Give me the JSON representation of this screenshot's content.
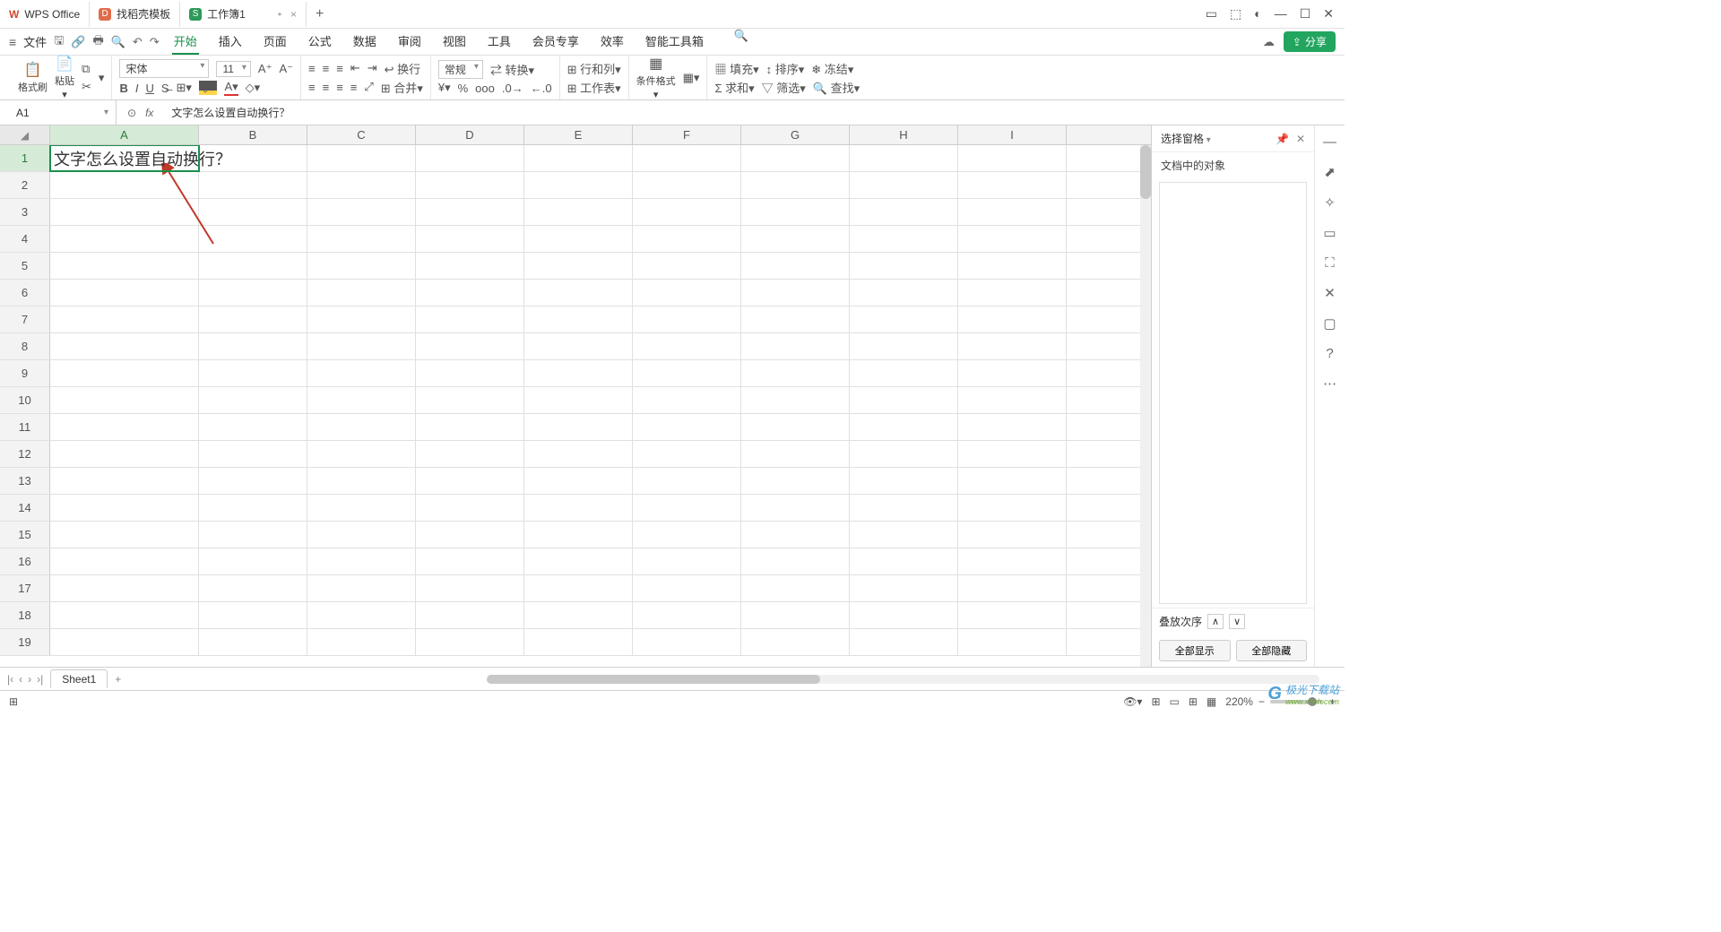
{
  "tabs": {
    "app": "WPS Office",
    "template": "找稻壳模板",
    "workbook": "工作簿1"
  },
  "menubar": {
    "file": "文件",
    "items": [
      "开始",
      "插入",
      "页面",
      "公式",
      "数据",
      "审阅",
      "视图",
      "工具",
      "会员专享",
      "效率",
      "智能工具箱"
    ],
    "active_index": 0,
    "share": "分享"
  },
  "ribbon": {
    "format_painter": "格式刷",
    "paste": "粘贴",
    "font_name": "宋体",
    "font_size": "11",
    "wrap": "换行",
    "merge": "合并",
    "number_format": "常规",
    "convert": "转换",
    "rowcol": "行和列",
    "worksheet": "工作表",
    "cond_format": "条件格式",
    "fill": "填充",
    "sort": "排序",
    "freeze": "冻结",
    "sum": "求和",
    "filter": "筛选",
    "find": "查找"
  },
  "formula_bar": {
    "name": "A1",
    "formula": "文字怎么设置自动换行？"
  },
  "grid": {
    "columns": [
      "A",
      "B",
      "C",
      "D",
      "E",
      "F",
      "G",
      "H",
      "I"
    ],
    "rows": 19,
    "cellA1": "文字怎么设置自动换行？"
  },
  "side_panel": {
    "title": "选择窗格",
    "subtitle": "文档中的对象",
    "order": "叠放次序",
    "show_all": "全部显示",
    "hide_all": "全部隐藏"
  },
  "sheet": {
    "name": "Sheet1"
  },
  "status": {
    "zoom": "220%"
  },
  "watermark": {
    "name": "极光下载站",
    "url": "www.xhch.com"
  }
}
